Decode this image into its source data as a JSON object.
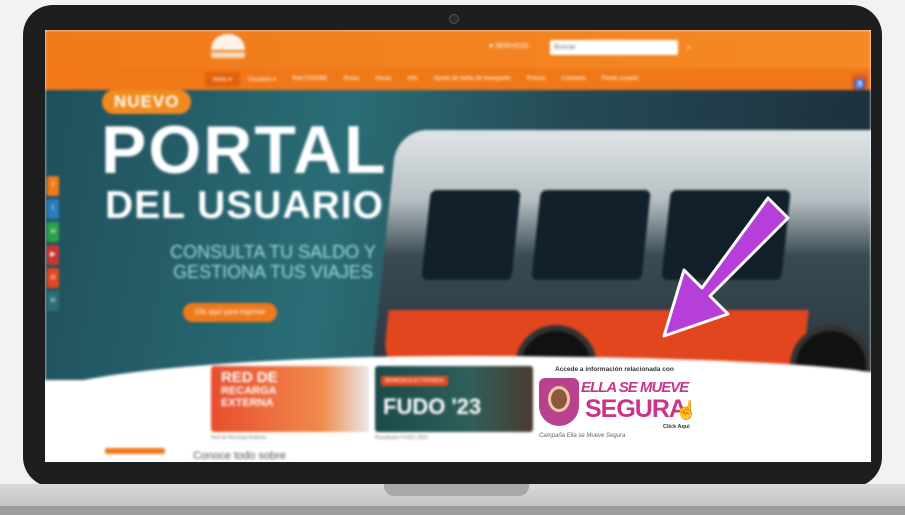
{
  "header": {
    "servicio": "♥ SERVICIO",
    "search_placeholder": "Buscar",
    "search_icon": "search-icon"
  },
  "nav": {
    "items": [
      "Inicio ▾",
      "Usuarios ▾",
      "Red CODIBE",
      "Rutas",
      "Horas",
      "Info",
      "Ajuste de tarifa de transporte",
      "Prensa",
      "Contacto",
      "Portal usuario"
    ]
  },
  "hero": {
    "badge": "NUEVO",
    "title_line1": "PORTAL",
    "title_line2": "DEL USUARIO",
    "subtitle_line1": "CONSULTA TU SALDO Y",
    "subtitle_line2": "GESTIONA TUS VIAJES",
    "cta": "Clic aquí para ingresar"
  },
  "cards": [
    {
      "line1": "RED DE",
      "line2": "RECARGA",
      "line3": "EXTERNA",
      "caption": "Red de Recarga Externa"
    },
    {
      "tag": "MONEDA ELECTRONICA",
      "title": "FUDO '23",
      "caption": "Resultados FUDO 2023"
    }
  ],
  "ella": {
    "heading": "Accede a información relacionada con",
    "line1": "ELLA SE MUEVE",
    "line2": "SEGURA",
    "click": "Click Aquí",
    "caption": "Campaña Ella se Mueve Segura"
  },
  "bottom": {
    "text": "Conoce todo sobre"
  },
  "colors": {
    "accent_orange": "#f07a1a",
    "arrow_purple": "#b63fd9",
    "ella_pink": "#c8368c"
  }
}
